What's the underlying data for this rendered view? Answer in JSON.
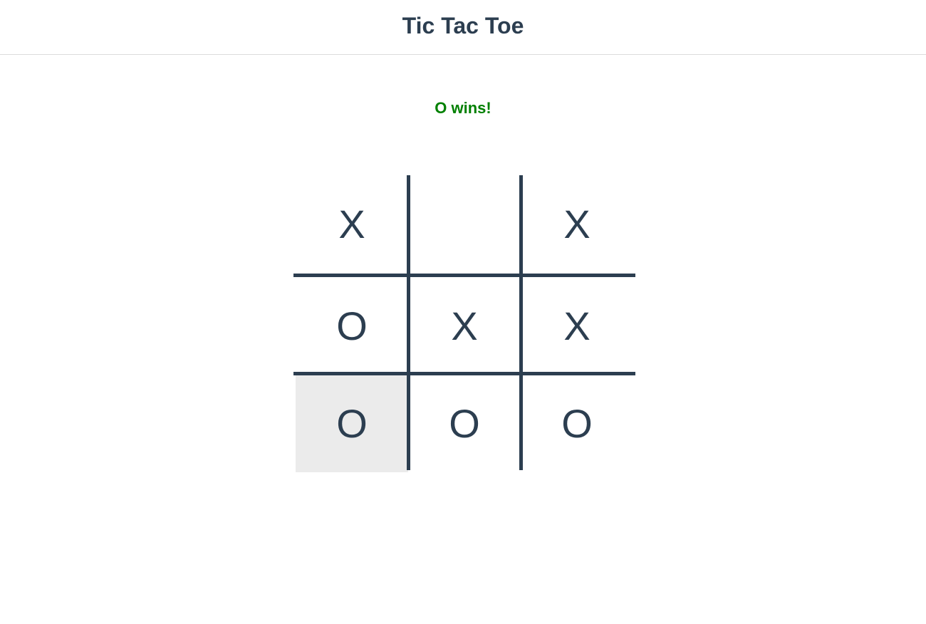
{
  "header": {
    "title": "Tic Tac Toe"
  },
  "status": {
    "text": "O wins!",
    "color": "#008000"
  },
  "board": {
    "cells": [
      "X",
      "",
      "X",
      "O",
      "X",
      "X",
      "O",
      "O",
      "O"
    ],
    "highlighted_cell_index": 6,
    "line_color": "#2c3e50",
    "highlight_color": "#ebebeb"
  }
}
